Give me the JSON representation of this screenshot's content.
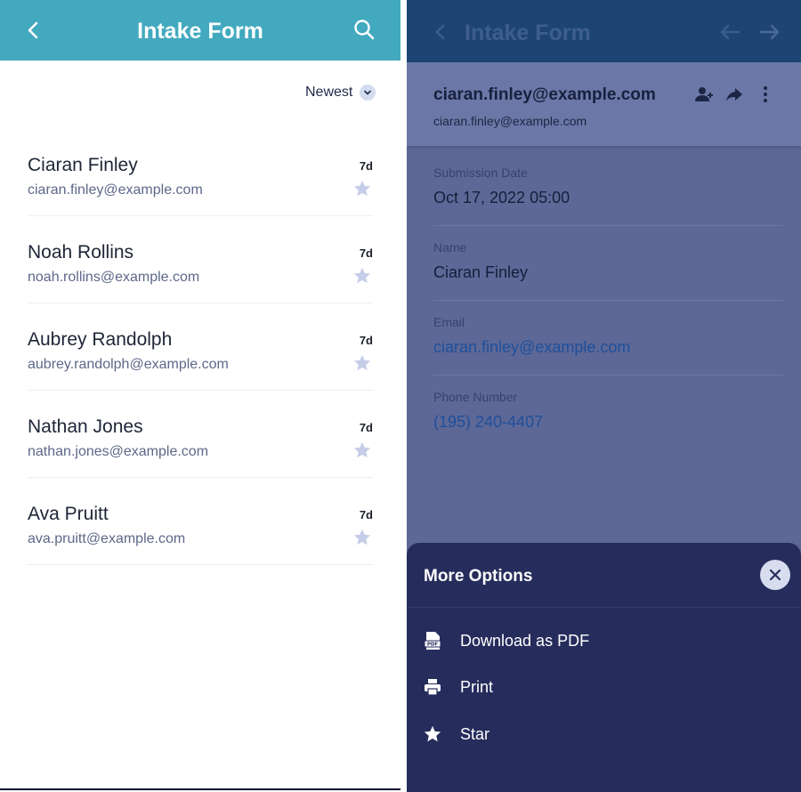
{
  "left": {
    "title": "Intake Form",
    "sort_label": "Newest",
    "items": [
      {
        "name": "Ciaran Finley",
        "email": "ciaran.finley@example.com",
        "age": "7d"
      },
      {
        "name": "Noah Rollins",
        "email": "noah.rollins@example.com",
        "age": "7d"
      },
      {
        "name": "Aubrey Randolph",
        "email": "aubrey.randolph@example.com",
        "age": "7d"
      },
      {
        "name": "Nathan Jones",
        "email": "nathan.jones@example.com",
        "age": "7d"
      },
      {
        "name": "Ava Pruitt",
        "email": "ava.pruitt@example.com",
        "age": "7d"
      }
    ]
  },
  "right": {
    "title": "Intake Form",
    "header_email_bold": "ciaran.finley@example.com",
    "header_email": "ciaran.finley@example.com",
    "fields": [
      {
        "label": "Submission Date",
        "value": "Oct 17, 2022 05:00"
      },
      {
        "label": "Name",
        "value": "Ciaran Finley"
      },
      {
        "label": "Email",
        "value": "ciaran.finley@example.com"
      },
      {
        "label": "Phone Number",
        "value": "(195) 240-4407"
      }
    ],
    "sheet": {
      "title": "More Options",
      "options": [
        {
          "label": "Download as PDF",
          "icon": "pdf-icon"
        },
        {
          "label": "Print",
          "icon": "printer-icon"
        },
        {
          "label": "Star",
          "icon": "star-icon"
        }
      ]
    }
  },
  "colors": {
    "header_teal": "#42a9bf",
    "dim_header": "#1e4474",
    "sheet_bg": "#262d5c",
    "star_inactive": "#c5cde8",
    "link": "#1f4f9a"
  }
}
